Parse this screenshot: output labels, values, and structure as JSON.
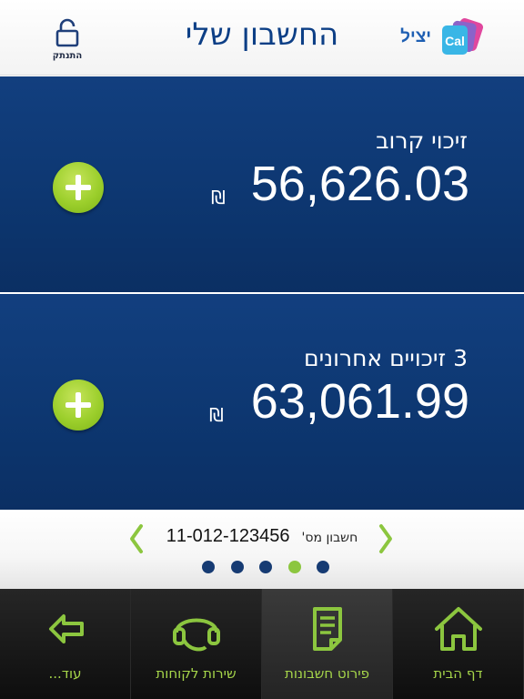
{
  "header": {
    "title": "החשבון שלי",
    "logout_label": "התנתק",
    "brand_text": "יציל",
    "brand_logo_text": "Cal"
  },
  "cards": [
    {
      "label": "זיכוי קרוב",
      "amount": "56,626.03",
      "currency": "₪"
    },
    {
      "label": "3 זיכויים אחרונים",
      "amount": "63,061.99",
      "currency": "₪"
    }
  ],
  "account": {
    "label": "חשבון מס'",
    "number": "11-012-123456",
    "page_count": 5,
    "active_page_index_from_left": 3
  },
  "tabs": [
    {
      "label": "עוד...",
      "icon": "back-arrow-icon"
    },
    {
      "label": "שירות לקוחות",
      "icon": "headset-icon"
    },
    {
      "label": "פירוט חשבונות",
      "icon": "document-icon",
      "selected": true
    },
    {
      "label": "דף הבית",
      "icon": "home-icon"
    }
  ],
  "colors": {
    "brand_blue": "#0d3f86",
    "card_blue": "#0d3771",
    "accent_green": "#8cc63f",
    "tab_bar": "#141414"
  }
}
